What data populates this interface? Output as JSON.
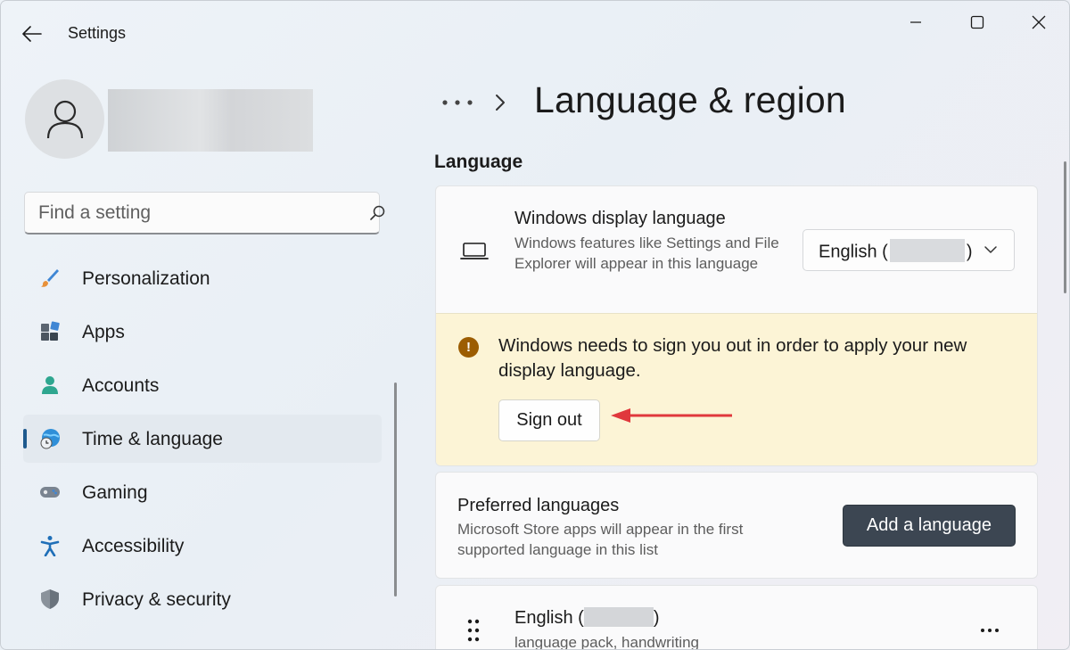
{
  "window": {
    "app_title": "Settings"
  },
  "search": {
    "placeholder": "Find a setting"
  },
  "sidebar": {
    "items": [
      {
        "label": "Personalization",
        "icon": "paintbrush-icon",
        "active": false
      },
      {
        "label": "Apps",
        "icon": "apps-icon",
        "active": false
      },
      {
        "label": "Accounts",
        "icon": "person-icon",
        "active": false
      },
      {
        "label": "Time & language",
        "icon": "globe-clock-icon",
        "active": true
      },
      {
        "label": "Gaming",
        "icon": "gamepad-icon",
        "active": false
      },
      {
        "label": "Accessibility",
        "icon": "accessibility-icon",
        "active": false
      },
      {
        "label": "Privacy & security",
        "icon": "shield-icon",
        "active": false
      }
    ]
  },
  "header": {
    "breadcrumb_more": "•••",
    "title": "Language & region"
  },
  "language_section": {
    "title": "Language",
    "display_language": {
      "title": "Windows display language",
      "description": "Windows features like Settings and File Explorer will appear in this language",
      "selected_prefix": "English (",
      "selected_suffix": ")"
    },
    "warning": {
      "text": "Windows needs to sign you out in order to apply your new display language.",
      "button_label": "Sign out"
    },
    "preferred": {
      "title": "Preferred languages",
      "description": "Microsoft Store apps will appear in the first supported language in this list",
      "button_label": "Add a language"
    },
    "installed_language": {
      "name_prefix": "English (",
      "name_suffix": ")",
      "features": "language pack, handwriting"
    }
  },
  "colors": {
    "accent": "#1e5a8e",
    "warning_bg": "#fcf4d6",
    "warning_icon": "#9c5d02",
    "primary_button": "#3c4652",
    "annotation_arrow": "#e0383c"
  }
}
